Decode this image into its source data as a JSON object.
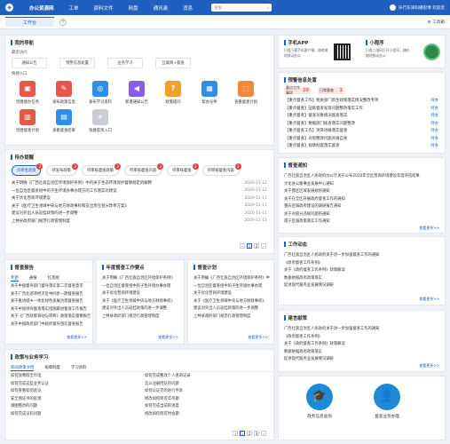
{
  "nav": {
    "items": [
      "办公资源网",
      "工单",
      "资料文件",
      "网盘",
      "通讯录",
      "消息"
    ],
    "search": "搜索",
    "user": "乐行东泽科播彭博 欢迎您"
  },
  "tabs": {
    "active": "工作台",
    "toolbox": "工具箱"
  },
  "mynav": {
    "title": "我的导航",
    "recent_label": "最近访问",
    "recent": [
      "通知公告",
      "预警信息处置",
      "业务学习",
      "互联网+督查"
    ],
    "quick_label": "快捷入口",
    "icons": [
      {
        "label": "创建督办任务",
        "color": "#e8564b",
        "glyph": "▣"
      },
      {
        "label": "发布政策信息",
        "color": "#e8564b",
        "glyph": "✎"
      },
      {
        "label": "发布学习资料",
        "color": "#2f8ee8",
        "glyph": "◎"
      },
      {
        "label": "新增通知公告",
        "color": "#8d5be6",
        "glyph": "◀"
      },
      {
        "label": "政策提问",
        "color": "#f0a02c",
        "glyph": "?"
      },
      {
        "label": "帮办证件",
        "color": "#2f8ee8",
        "glyph": "▦"
      },
      {
        "label": "查看督查计划",
        "color": "#f08a3a",
        "glyph": "⬚"
      },
      {
        "label": "创建督查计划",
        "color": "#e8564b",
        "glyph": "▥"
      },
      {
        "label": "查看督查结果",
        "color": "#2f8ee8",
        "glyph": "▤"
      },
      {
        "label": "快捷菜单入口",
        "color": "#c9ccd3",
        "glyph": "+"
      }
    ]
  },
  "todo": {
    "title": "待办提醒",
    "tabs": [
      {
        "label": "待审批政策",
        "n": "2"
      },
      {
        "label": "待发布政策",
        "n": "3"
      },
      {
        "label": "待审核督查政策",
        "n": "3"
      },
      {
        "label": "待审核督查内容",
        "n": "3"
      },
      {
        "label": "待审核督查",
        "n": "3"
      },
      {
        "label": "待审核督查内容",
        "n": "3"
      }
    ],
    "rows": [
      {
        "t": "关于明确《广西壮族自治区环境保护条例》中的关于生态环境保护督察规定的解释",
        "d": "2020-11-11"
      },
      {
        "t": "一位自治区督查组中的子生环境办事办理方的工作落实的建议",
        "d": "2020-11-11"
      },
      {
        "t": "关于优化营商环境建设",
        "d": "2020-11-11"
      },
      {
        "t": "关于《医疗卫生领域中央与地方财政事权和支出责任划分改革方案》",
        "d": "2020-11-11"
      },
      {
        "t": "建议对外出人员返桂政策的进一步调整",
        "d": "2020-11-11"
      },
      {
        "t": "上林县政府部门规范行政管理制度",
        "d": "2020-11-11"
      }
    ],
    "pages": [
      "1",
      "2"
    ]
  },
  "report": {
    "title": "督查报告",
    "tabs": [
      "专题",
      "通报",
      "红黑榜"
    ],
    "rows": [
      "关于中国督导部门督导落实第二次督查意见",
      "关于广西北部湾经济区中同步一期督查报告",
      "关于推进城乡一体化绿色发展治理督查报告",
      "关于中国领导督查落实措施跟进督查工作报告",
      "关于《广西政策调动与转移》政策落实督察报告",
      "关于中国政府部门中政府督导落实督查报告"
    ],
    "more": "查看更多>>"
  },
  "annual": {
    "title": "年度督查工作要点",
    "rows": [
      "关于明确《广西壮族自治区环境保护条例》",
      "一位自治区督查组中的子生环境办事办理",
      "关于优化营商环境建设",
      "关于《医疗卫生领域中央与地方财政事权》",
      "建议对外出人员返桂政策的进一步调整",
      "上林县政府部门规范行政管理制度"
    ],
    "more": "查看更多>>"
  },
  "plan": {
    "title": "督查计划",
    "rows": [
      "关于明确《广西壮族自治区环境保护条例》中",
      "一位自治区督查组中的子生环境办事办理",
      "关于优化营商环境建设",
      "关于《医疗卫生领域中央与地方财政事权》",
      "建议对外出人员返桂政策的进一步调整",
      "上林县政府部门规范行政管理制度"
    ],
    "more": "查看更多>>"
  },
  "policy": {
    "title": "政策与业务学习",
    "tabs": [
      "新闻政策文档",
      "规章制度",
      "学习资料"
    ],
    "left": [
      "如何放寒假全市电",
      "如何完成这些业务认证",
      "如何查看如何验证",
      "安全感证书的处理",
      "请图整改的问题",
      "如何完成证码问题"
    ],
    "right": [
      "如何完成整改个人查询记录",
      "怎么注册团队的问题",
      "如何认证完的进行申诉",
      "修改如何到可年待期",
      "如何完成当前的进度",
      "修改如何到可时会期"
    ],
    "pages": [
      "1",
      "2",
      "3"
    ]
  },
  "app": {
    "title": "手机APP",
    "desc": "扫描下载手机客户端，随时随地移动办公",
    "mini_title": "小程序",
    "mini_desc": "扫描二维码打开小程序，随时随地移动办公"
  },
  "warn": {
    "title": "预警信息处置",
    "tags": [
      {
        "label": "重点工作事项",
        "n": "10"
      },
      {
        "label": "日常督查",
        "n": "3"
      }
    ],
    "rows": [
      "【重点督查工作】相关部门新生政策落实情况整改专项",
      "【重点督查】国家督查发现问题整改落实工作",
      "【重点督查】督查对象情况督查落实",
      "【重点督查】数据部门核查落实问题整改",
      "【重点督查工作】项目进展落实督查",
      "【重点督查】对照整改问题开展自查",
      "【重点督查】规章制度落实督查"
    ],
    "st": "待办"
  },
  "notice": {
    "title": "督查通知",
    "rows": [
      "广西壮族自治区人民政府办公厅关于公布2020年全区营商环境建设年度评选结果",
      "大化县公路事业发展中心通知",
      "关于我区区域发展规划通知",
      "关于在全区开展政府督查工作的通知",
      "重庆区域政府建设的调研报告通知",
      "关于对部分违规问题的通知",
      "南宁区域政策落实工作通知"
    ],
    "more": "查看更多>>"
  },
  "dyn": {
    "title": "工作动态",
    "rows": [
      "广西壮族自治区人民政府关于进一步加强督查工作的通知",
      "《政府督查工作条例》",
      "关于《政府督查工作条例》政策解读",
      "数据依据政府政策落实",
      "促进现代服务业发展情况调研"
    ],
    "more": "查看更多>>"
  },
  "suggest": {
    "title": "建言献策",
    "rows": [
      "广西壮族自治区人民政府关于进一步加强督查工作的通知",
      "《政府督查工作条例》",
      "关于《政府督查工作条例》政策解读",
      "数据依据政府政策落实",
      "促进现代服务业发展情况调研"
    ],
    "more": "查看更多>>"
  },
  "bottom": {
    "a": "政务信息查询",
    "b": "督查业务办理"
  }
}
